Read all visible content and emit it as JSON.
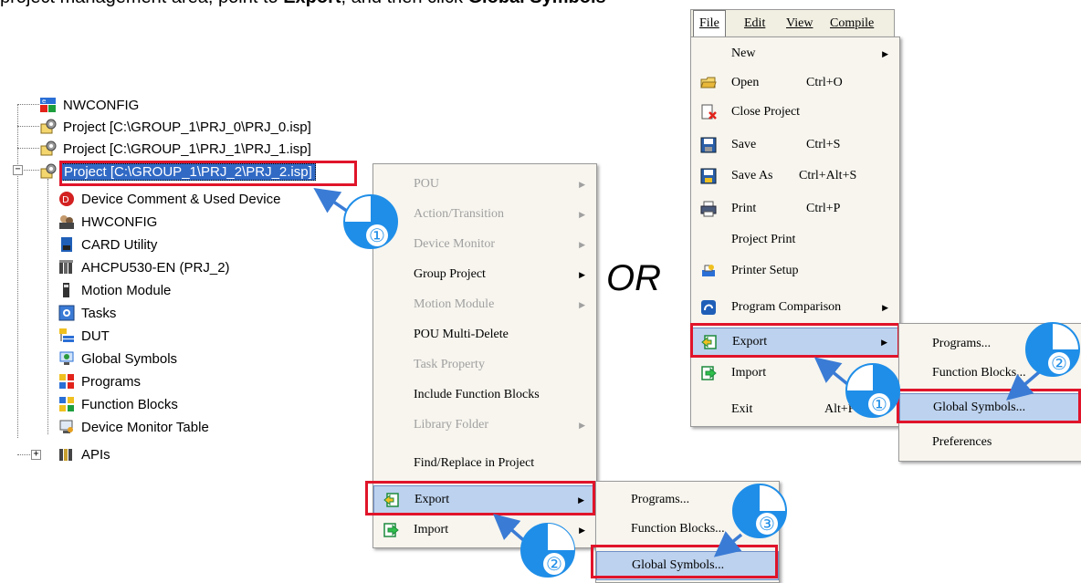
{
  "heading": {
    "pre": "project management area, point to ",
    "b1": "Export",
    "mid": ", and then click ",
    "b2": "Global Symbols"
  },
  "tree": {
    "items": [
      {
        "label": "NWCONFIG",
        "icon": "nwconfig-icon"
      },
      {
        "label": "Project [C:\\GROUP_1\\PRJ_0\\PRJ_0.isp]",
        "icon": "project-icon"
      },
      {
        "label": "Project [C:\\GROUP_1\\PRJ_1\\PRJ_1.isp]",
        "icon": "project-icon"
      },
      {
        "label": "Project [C:\\GROUP_1\\PRJ_2\\PRJ_2.isp]",
        "icon": "project-icon",
        "selected": true
      },
      {
        "label": "Device Comment & Used Device",
        "icon": "device-comment-icon"
      },
      {
        "label": "HWCONFIG",
        "icon": "hwconfig-icon"
      },
      {
        "label": "CARD Utility",
        "icon": "card-utility-icon"
      },
      {
        "label": "AHCPU530-EN  (PRJ_2)",
        "icon": "cpu-icon"
      },
      {
        "label": "Motion Module",
        "icon": "motion-module-icon"
      },
      {
        "label": "Tasks",
        "icon": "tasks-icon"
      },
      {
        "label": "DUT",
        "icon": "dut-icon"
      },
      {
        "label": "Global Symbols",
        "icon": "global-symbols-icon"
      },
      {
        "label": "Programs",
        "icon": "programs-icon"
      },
      {
        "label": "Function Blocks",
        "icon": "function-blocks-icon"
      },
      {
        "label": "Device Monitor Table",
        "icon": "device-monitor-icon"
      },
      {
        "label": "APIs",
        "icon": "apis-icon"
      }
    ],
    "collapse_symbol": "−",
    "expand_symbol": "+"
  },
  "context_menu": {
    "items": [
      {
        "label": "POU",
        "disabled": true,
        "submenu": true
      },
      {
        "label": "Action/Transition",
        "disabled": true,
        "submenu": true
      },
      {
        "label": "Device Monitor",
        "disabled": true,
        "submenu": true
      },
      {
        "label": "Group Project",
        "disabled": false,
        "submenu": true
      },
      {
        "label": "Motion Module",
        "disabled": true,
        "submenu": true
      },
      {
        "label": "POU Multi-Delete",
        "disabled": false,
        "submenu": false
      },
      {
        "label": "Task Property",
        "disabled": true,
        "submenu": false
      },
      {
        "label": "Include Function Blocks",
        "disabled": false,
        "submenu": false
      },
      {
        "label": "Library Folder",
        "disabled": true,
        "submenu": true
      },
      {
        "label": "Find/Replace in Project",
        "disabled": false,
        "submenu": false
      },
      {
        "label": "Export",
        "disabled": false,
        "submenu": true,
        "highlight": true
      },
      {
        "label": "Import",
        "disabled": false,
        "submenu": true
      }
    ],
    "submenu": [
      "Programs...",
      "Function Blocks...",
      "Global Symbols..."
    ]
  },
  "or_label": "OR",
  "menubar": {
    "items": [
      "File",
      "Edit",
      "View",
      "Compile"
    ]
  },
  "file_menu": {
    "items": [
      {
        "label": "New",
        "shortcut": "",
        "submenu": true,
        "icon": ""
      },
      {
        "label": "Open",
        "shortcut": "Ctrl+O",
        "icon": "open-folder-icon"
      },
      {
        "label": "Close Project",
        "shortcut": "",
        "icon": "close-project-icon"
      },
      {
        "label": "Save",
        "shortcut": "Ctrl+S",
        "icon": "save-icon"
      },
      {
        "label": "Save As",
        "shortcut": "Ctrl+Alt+S",
        "icon": "save-as-icon"
      },
      {
        "label": "Print",
        "shortcut": "Ctrl+P",
        "icon": "print-icon"
      },
      {
        "label": "Project Print",
        "shortcut": "",
        "icon": ""
      },
      {
        "label": "Printer Setup",
        "shortcut": "",
        "icon": "printer-setup-icon"
      },
      {
        "label": "Program Comparison",
        "shortcut": "",
        "submenu": true,
        "icon": "program-comparison-icon"
      },
      {
        "label": "Export",
        "shortcut": "",
        "submenu": true,
        "highlight": true,
        "icon": "export-icon"
      },
      {
        "label": "Import",
        "shortcut": "",
        "icon": "import-icon"
      },
      {
        "label": "Exit",
        "shortcut": "Alt+F4",
        "icon": ""
      }
    ],
    "submenu": [
      "Programs...",
      "Function Blocks...",
      "Global Symbols...",
      "Preferences"
    ]
  },
  "step_badges": [
    "①",
    "②",
    "③",
    "①",
    "②"
  ],
  "colors": {
    "accent_red": "#e0142a",
    "badge_blue": "#1f8ee8",
    "arrow_blue": "#3a7bd5",
    "selection": "#316ac5",
    "menu_highlight": "#bdd2ee"
  }
}
